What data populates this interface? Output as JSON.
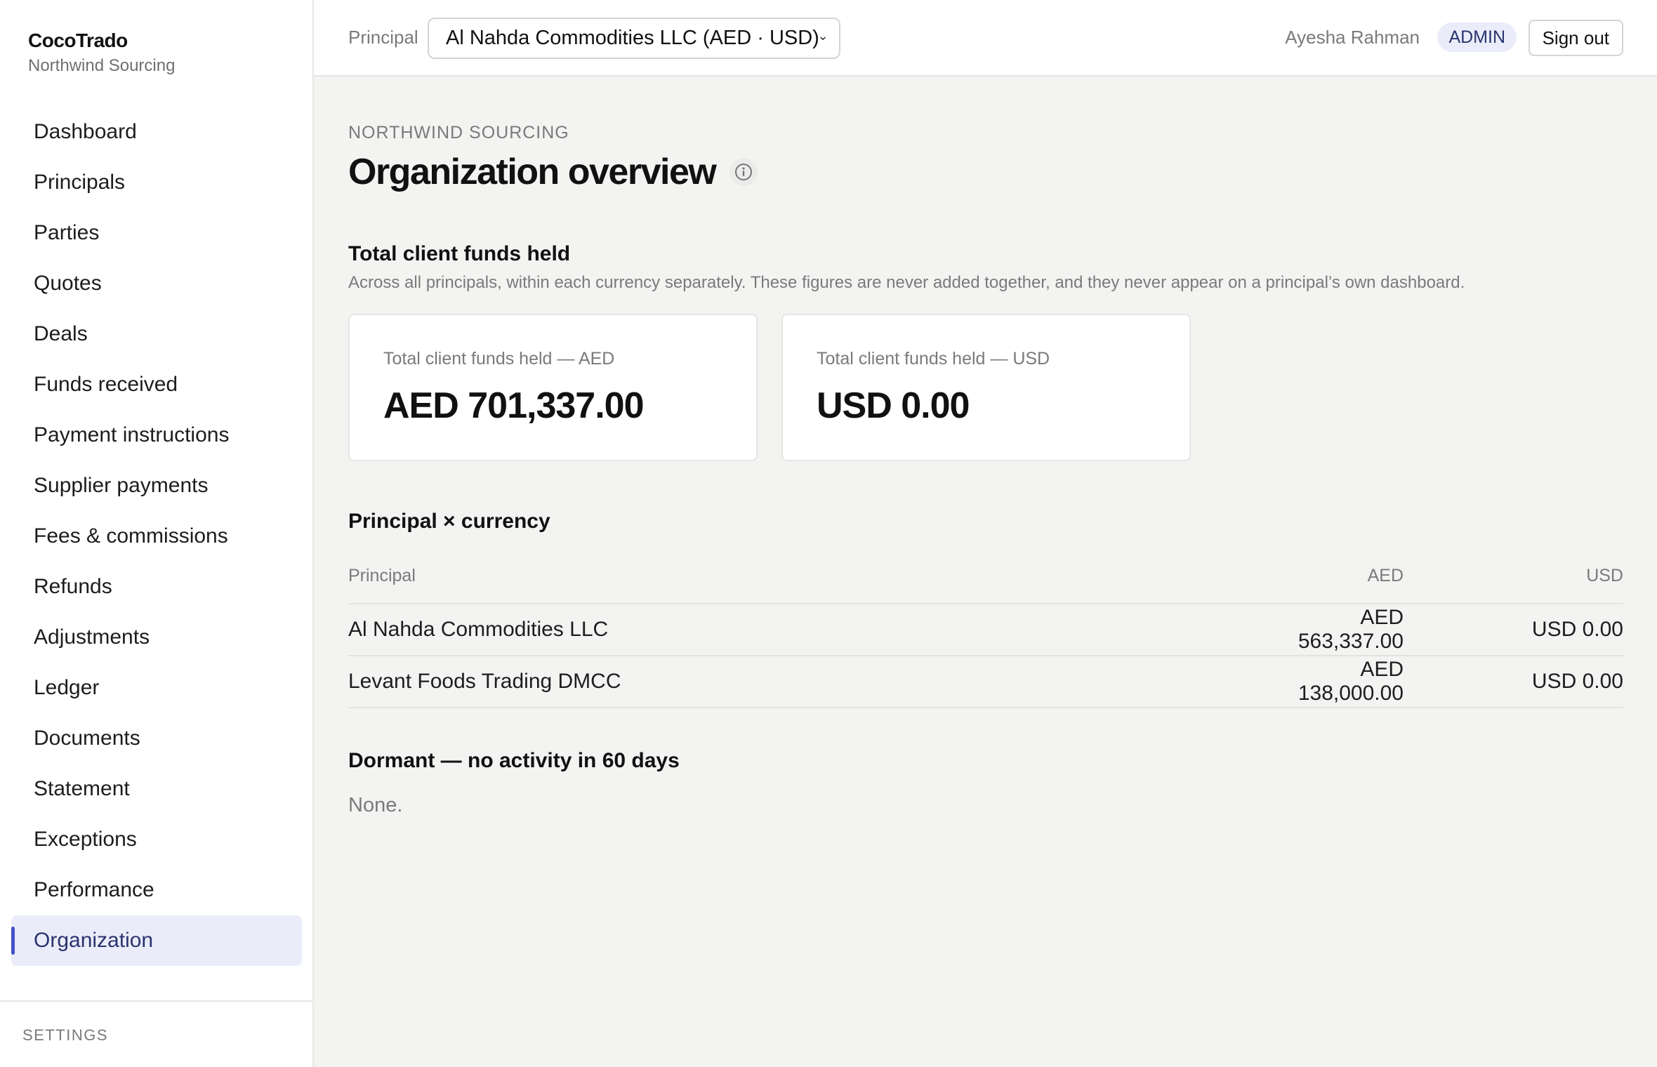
{
  "brand": {
    "name": "CocoTrado",
    "org": "Northwind Sourcing"
  },
  "nav": {
    "items": [
      {
        "label": "Dashboard",
        "active": false
      },
      {
        "label": "Principals",
        "active": false
      },
      {
        "label": "Parties",
        "active": false
      },
      {
        "label": "Quotes",
        "active": false
      },
      {
        "label": "Deals",
        "active": false
      },
      {
        "label": "Funds received",
        "active": false
      },
      {
        "label": "Payment instructions",
        "active": false
      },
      {
        "label": "Supplier payments",
        "active": false
      },
      {
        "label": "Fees & commissions",
        "active": false
      },
      {
        "label": "Refunds",
        "active": false
      },
      {
        "label": "Adjustments",
        "active": false
      },
      {
        "label": "Ledger",
        "active": false
      },
      {
        "label": "Documents",
        "active": false
      },
      {
        "label": "Statement",
        "active": false
      },
      {
        "label": "Exceptions",
        "active": false
      },
      {
        "label": "Performance",
        "active": false
      },
      {
        "label": "Organization",
        "active": true
      }
    ],
    "settings_heading": "SETTINGS"
  },
  "topbar": {
    "principal_label": "Principal",
    "principal_selected": "Al Nahda Commodities LLC (AED · USD)",
    "user_name": "Ayesha Rahman",
    "role": "ADMIN",
    "sign_out_label": "Sign out"
  },
  "page": {
    "eyebrow": "NORTHWIND SOURCING",
    "title": "Organization overview"
  },
  "totals": {
    "title": "Total client funds held",
    "description": "Across all principals, within each currency separately. These figures are never added together, and they never appear on a principal’s own dashboard.",
    "cards": [
      {
        "label": "Total client funds held — AED",
        "value": "AED 701,337.00"
      },
      {
        "label": "Total client funds held — USD",
        "value": "USD 0.00"
      }
    ]
  },
  "matrix": {
    "title": "Principal × currency",
    "headers": {
      "principal": "Principal",
      "aed": "AED",
      "usd": "USD"
    },
    "rows": [
      {
        "principal": "Al Nahda Commodities LLC",
        "aed": "AED 563,337.00",
        "usd": "USD 0.00"
      },
      {
        "principal": "Levant Foods Trading DMCC",
        "aed": "AED 138,000.00",
        "usd": "USD 0.00"
      }
    ]
  },
  "dormant": {
    "title": "Dormant — no activity in 60 days",
    "empty_text": "None."
  },
  "icons": {
    "info": "info-icon",
    "select_chevron": "chevron-down-icon"
  },
  "colors": {
    "accent": "#4452c9",
    "active_bg": "#eaedf9",
    "active_text": "#2b3370"
  }
}
